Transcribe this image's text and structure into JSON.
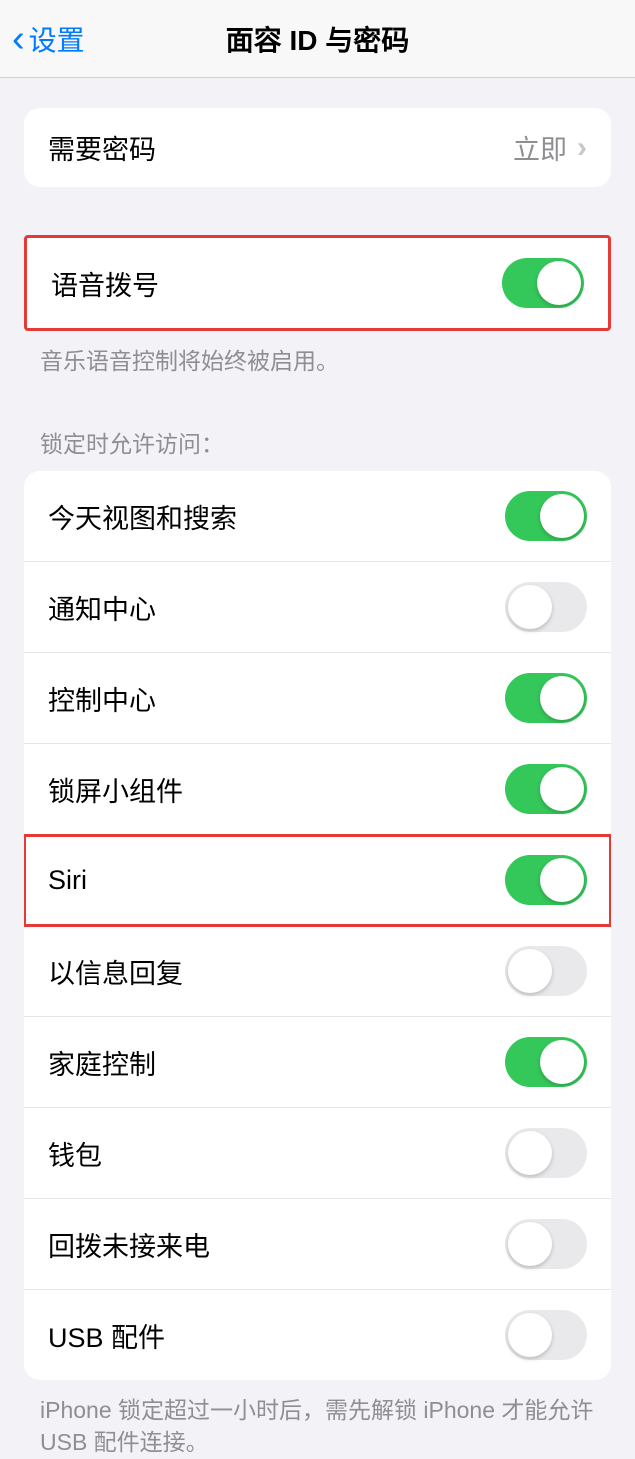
{
  "nav": {
    "back_label": "设置",
    "title": "面容 ID 与密码"
  },
  "passcode": {
    "label": "需要密码",
    "value": "立即"
  },
  "voice_dial": {
    "label": "语音拨号",
    "footer": "音乐语音控制将始终被启用。"
  },
  "lockscreen_section": {
    "header": "锁定时允许访问："
  },
  "lockscreen_items": [
    {
      "label": "今天视图和搜索",
      "on": true
    },
    {
      "label": "通知中心",
      "on": false
    },
    {
      "label": "控制中心",
      "on": true
    },
    {
      "label": "锁屏小组件",
      "on": true
    },
    {
      "label": "Siri",
      "on": true
    },
    {
      "label": "以信息回复",
      "on": false
    },
    {
      "label": "家庭控制",
      "on": true
    },
    {
      "label": "钱包",
      "on": false
    },
    {
      "label": "回拨未接来电",
      "on": false
    },
    {
      "label": "USB 配件",
      "on": false
    }
  ],
  "usb_footer": "iPhone 锁定超过一小时后，需先解锁 iPhone 才能允许 USB 配件连接。"
}
